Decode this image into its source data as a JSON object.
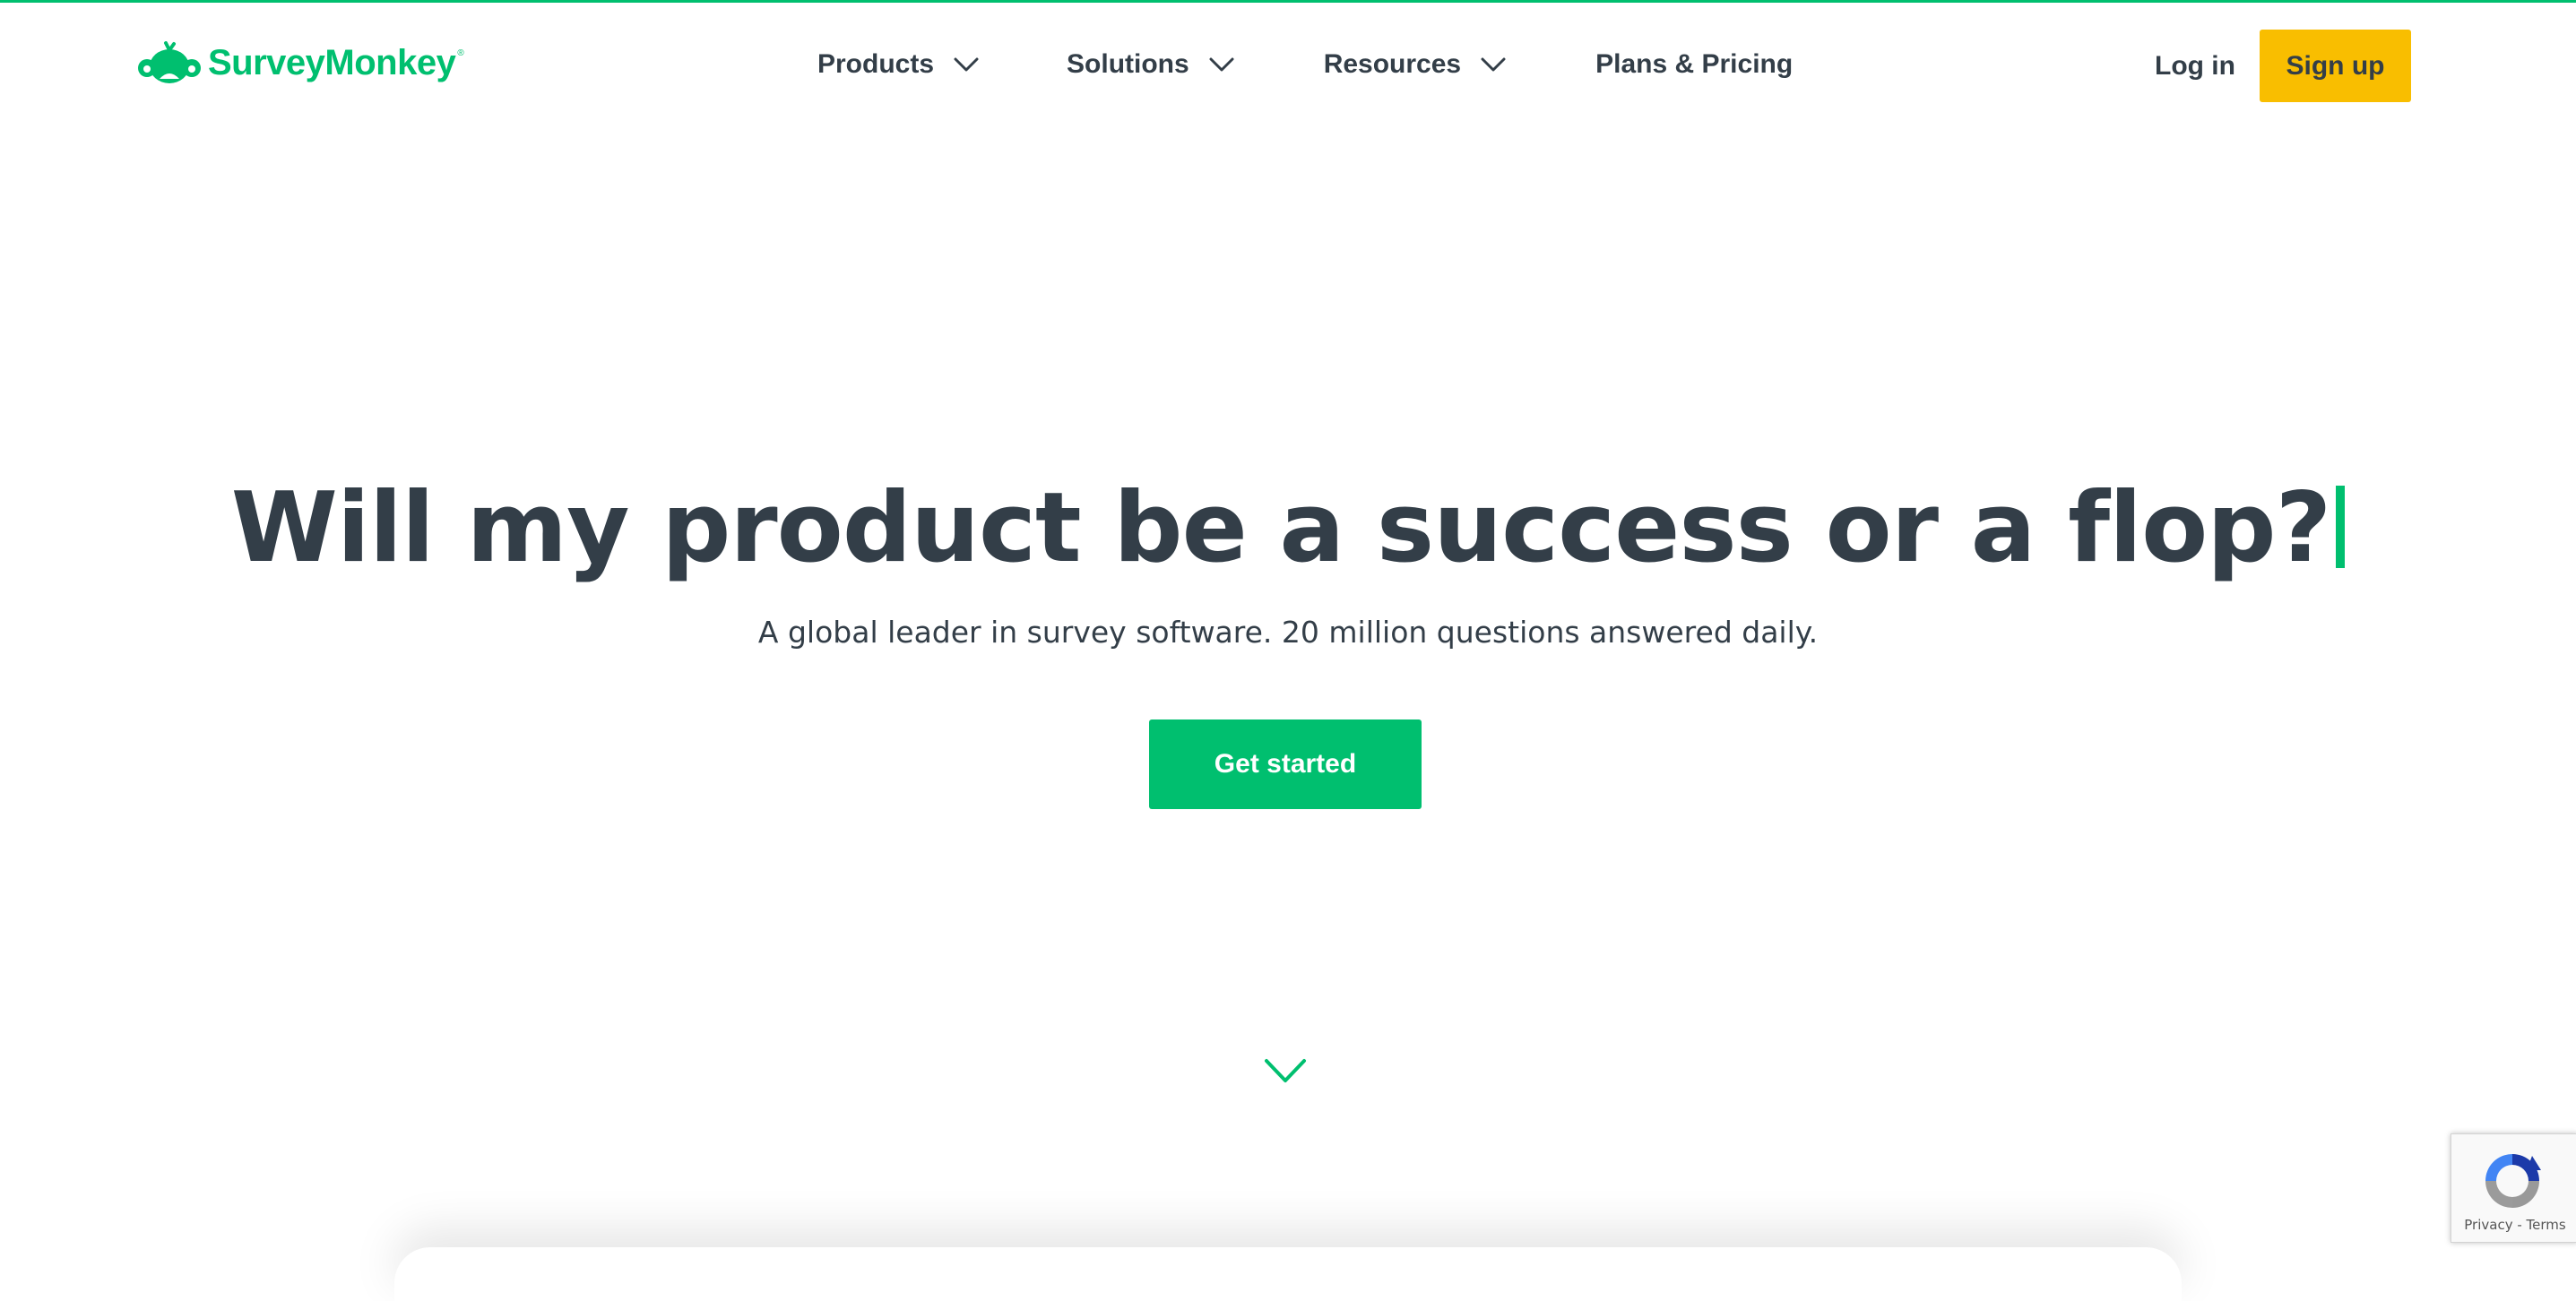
{
  "brand": {
    "name": "SurveyMonkey",
    "registered_mark": "®",
    "logo_icon": "monkey-logo-icon",
    "accent_color": "#00bf6f"
  },
  "nav": {
    "items": [
      {
        "label": "Products",
        "has_dropdown": true,
        "icon": "chevron-down-icon"
      },
      {
        "label": "Solutions",
        "has_dropdown": true,
        "icon": "chevron-down-icon"
      },
      {
        "label": "Resources",
        "has_dropdown": true,
        "icon": "chevron-down-icon"
      },
      {
        "label": "Plans & Pricing",
        "has_dropdown": false
      }
    ],
    "login_label": "Log in",
    "signup_label": "Sign up",
    "signup_color": "#f9be00"
  },
  "hero": {
    "title": "Will my product be a success or a flop?",
    "subtitle": "A global leader in survey software. 20 million questions answered daily.",
    "cta_label": "Get started",
    "cta_color": "#00bf6f",
    "text_color": "#333e48",
    "scroll_icon": "chevron-down-icon"
  },
  "recaptcha": {
    "icon": "recaptcha-icon",
    "privacy_label": "Privacy",
    "separator": " - ",
    "terms_label": "Terms"
  }
}
